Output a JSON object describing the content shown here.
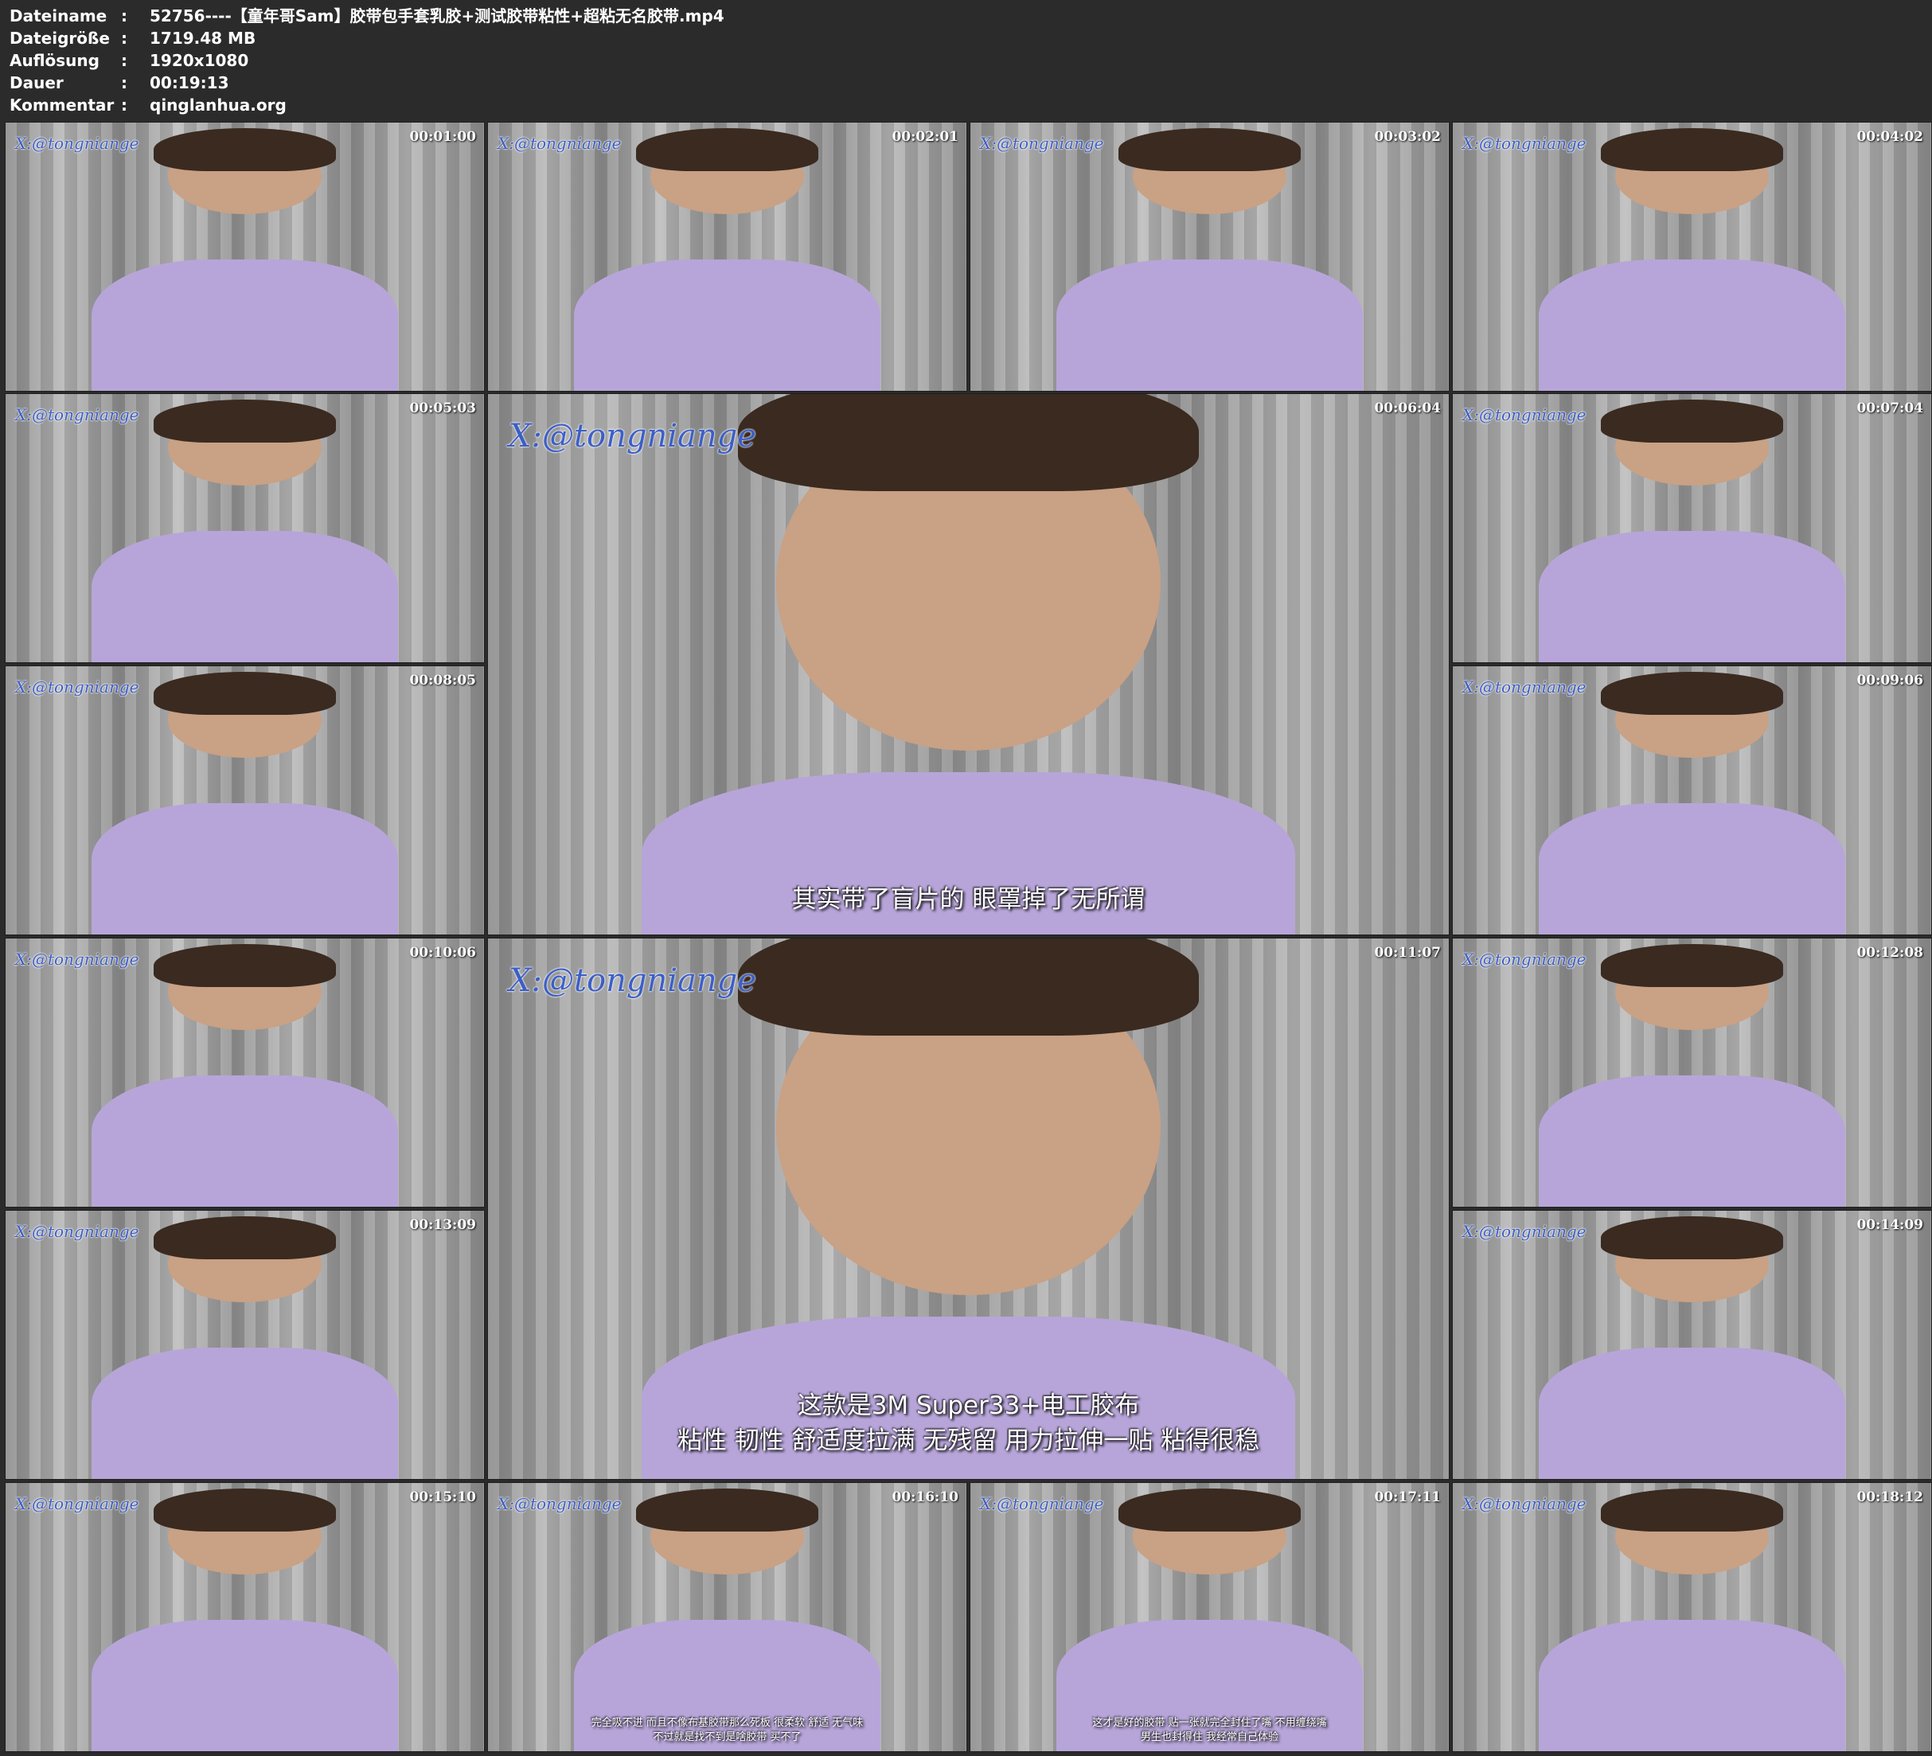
{
  "info": [
    {
      "key": "Dateiname",
      "sep": ":",
      "value": "52756----【童年哥Sam】胶带包手套乳胶+测试胶带粘性+超粘无名胶带.mp4"
    },
    {
      "key": "Dateigröße",
      "sep": ":",
      "value": "1719.48 MB"
    },
    {
      "key": "Auflösung",
      "sep": ":",
      "value": "1920x1080"
    },
    {
      "key": "Dauer",
      "sep": ":",
      "value": "00:19:13"
    },
    {
      "key": "Kommentar",
      "sep": ":",
      "value": "qinglanhua.org"
    }
  ],
  "watermark": "X:@tongniange",
  "frames": [
    {
      "time": "00:01:00",
      "subtitle": []
    },
    {
      "time": "00:02:01",
      "subtitle": []
    },
    {
      "time": "00:03:02",
      "subtitle": []
    },
    {
      "time": "00:04:02",
      "subtitle": []
    },
    {
      "time": "00:05:03",
      "subtitle": []
    },
    {
      "time": "00:06:04",
      "subtitle": [
        "其实带了盲片的 眼罩掉了无所谓"
      ]
    },
    {
      "time": "00:07:04",
      "subtitle": []
    },
    {
      "time": "00:08:05",
      "subtitle": []
    },
    {
      "time": "00:09:06",
      "subtitle": []
    },
    {
      "time": "00:10:06",
      "subtitle": []
    },
    {
      "time": "00:11:07",
      "subtitle": [
        "这款是3M Super33+电工胶布",
        "粘性 韧性 舒适度拉满 无残留 用力拉伸一贴 粘得很稳"
      ]
    },
    {
      "time": "00:12:08",
      "subtitle": []
    },
    {
      "time": "00:13:09",
      "subtitle": []
    },
    {
      "time": "00:14:09",
      "subtitle": []
    },
    {
      "time": "00:15:10",
      "subtitle": []
    },
    {
      "time": "00:16:10",
      "subtitle": [
        "完全吸不进 而且不像布基胶带那么死板 很柔软 舒适 无气味",
        "不过就是找不到是啥胶带 买不了"
      ]
    },
    {
      "time": "00:17:11",
      "subtitle": [
        "这才是好的胶带 贴一张就完全封住了嘴 不用缠绕嘴",
        "男生也封得住 我经常自己体验"
      ]
    },
    {
      "time": "00:18:12",
      "subtitle": []
    }
  ]
}
